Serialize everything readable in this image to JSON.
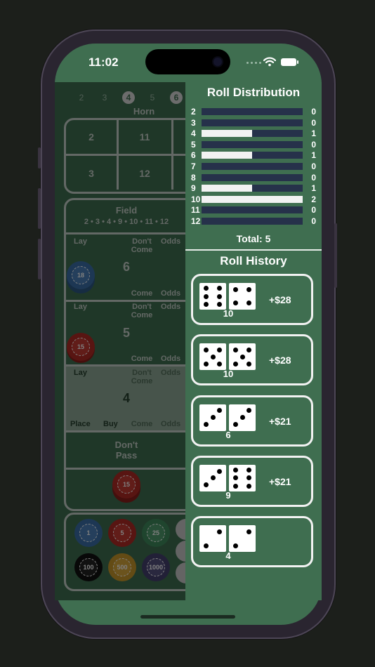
{
  "status": {
    "time": "11:02"
  },
  "table": {
    "point_numbers": [
      "2",
      "3",
      "4",
      "5",
      "6"
    ],
    "selected_point": "4",
    "horn_label": "Horn",
    "horn_cells": [
      "2",
      "11",
      "3",
      "12"
    ],
    "field_label": "Field",
    "field_numbers": "2 • 3 • 4 • 9 • 10 • 11 • 12",
    "lay": "Lay",
    "dont_come": "Don't Come",
    "odds": "Odds",
    "come": "Come",
    "place": "Place",
    "buy": "Buy",
    "boxes": [
      "6",
      "5",
      "4"
    ],
    "dont_pass": "Don't Pass",
    "chip_bets": [
      "18",
      "15",
      "15"
    ],
    "rack_chips": [
      "1",
      "5",
      "25",
      "100",
      "500",
      "1000"
    ]
  },
  "distribution": {
    "title": "Roll Distribution",
    "rows": [
      {
        "label": "2",
        "count": 0
      },
      {
        "label": "3",
        "count": 0
      },
      {
        "label": "4",
        "count": 1
      },
      {
        "label": "5",
        "count": 0
      },
      {
        "label": "6",
        "count": 1
      },
      {
        "label": "7",
        "count": 0
      },
      {
        "label": "8",
        "count": 0
      },
      {
        "label": "9",
        "count": 1
      },
      {
        "label": "10",
        "count": 2
      },
      {
        "label": "11",
        "count": 0
      },
      {
        "label": "12",
        "count": 0
      }
    ],
    "max": 2,
    "total_label": "Total: 5"
  },
  "history": {
    "title": "Roll History",
    "rolls": [
      {
        "die1": 6,
        "die2": 4,
        "sum": "10",
        "win": "+$28"
      },
      {
        "die1": 5,
        "die2": 5,
        "sum": "10",
        "win": "+$28"
      },
      {
        "die1": 3,
        "die2": 3,
        "sum": "6",
        "win": "+$21"
      },
      {
        "die1": 3,
        "die2": 6,
        "sum": "9",
        "win": "+$21"
      },
      {
        "die1": 2,
        "die2": 2,
        "sum": "4",
        "win": ""
      }
    ]
  },
  "colors": {
    "felt": "#3f6e50",
    "bar_track": "#26314a",
    "bar_fill": "#f2f2f2"
  }
}
